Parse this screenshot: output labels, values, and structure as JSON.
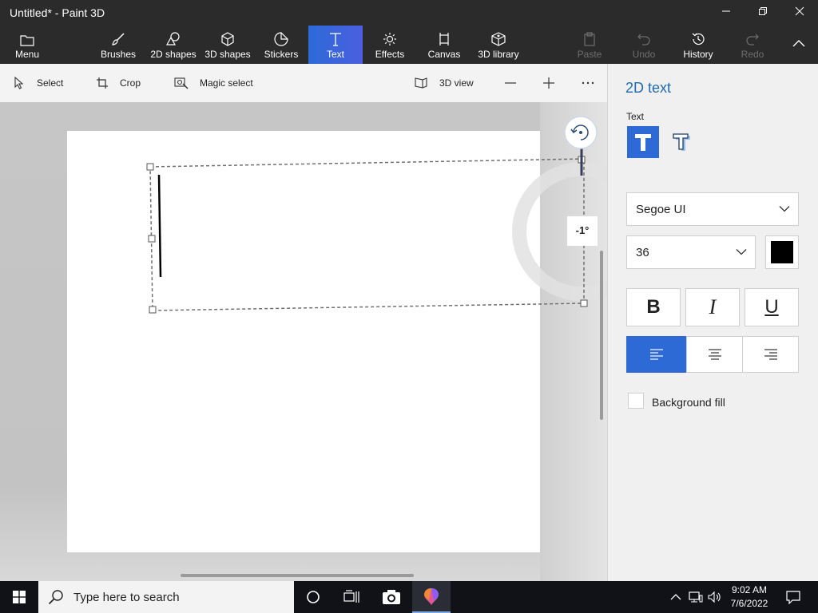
{
  "window": {
    "title": "Untitled* - Paint 3D",
    "minimize_icon": "minimize-icon",
    "maximize_icon": "restore-icon",
    "close_icon": "close-icon"
  },
  "ribbon": {
    "menu_label": "Menu",
    "items": [
      {
        "label": "Brushes",
        "icon": "brush-icon"
      },
      {
        "label": "2D shapes",
        "icon": "2d-shapes-icon"
      },
      {
        "label": "3D shapes",
        "icon": "3d-shapes-icon"
      },
      {
        "label": "Stickers",
        "icon": "stickers-icon"
      },
      {
        "label": "Text",
        "icon": "text-icon",
        "active": true
      },
      {
        "label": "Effects",
        "icon": "effects-icon"
      },
      {
        "label": "Canvas",
        "icon": "canvas-icon"
      },
      {
        "label": "3D library",
        "icon": "3d-library-icon"
      }
    ],
    "right_items": [
      {
        "label": "Paste",
        "icon": "paste-icon",
        "disabled": true
      },
      {
        "label": "Undo",
        "icon": "undo-icon",
        "disabled": true
      },
      {
        "label": "History",
        "icon": "history-icon",
        "disabled": false
      },
      {
        "label": "Redo",
        "icon": "redo-icon",
        "disabled": true
      }
    ],
    "collapse_icon": "chevron-up-icon"
  },
  "toolbar": {
    "select_label": "Select",
    "crop_label": "Crop",
    "magic_select_label": "Magic select",
    "view_3d_label": "3D view",
    "zoom_out_icon": "minus-icon",
    "zoom_in_icon": "plus-icon",
    "more_icon": "ellipsis-icon"
  },
  "canvas": {
    "rotation_readout": "-1°",
    "rotate_handle_icon": "rotate-icon"
  },
  "panel": {
    "title": "2D text",
    "text_label": "Text",
    "font_family": "Segoe UI",
    "font_size": "36",
    "text_color": "#000000",
    "background_fill_label": "Background fill",
    "background_fill_checked": false,
    "style_icons": [
      "bold-icon",
      "italic-icon",
      "underline-icon"
    ],
    "align_icons": [
      "align-left-icon",
      "align-center-icon",
      "align-right-icon"
    ],
    "active_alignment": "left",
    "accent_color": "#2d6ad6"
  },
  "taskbar": {
    "search_placeholder": "Type here to search",
    "time": "9:02 AM",
    "date": "7/6/2022"
  }
}
